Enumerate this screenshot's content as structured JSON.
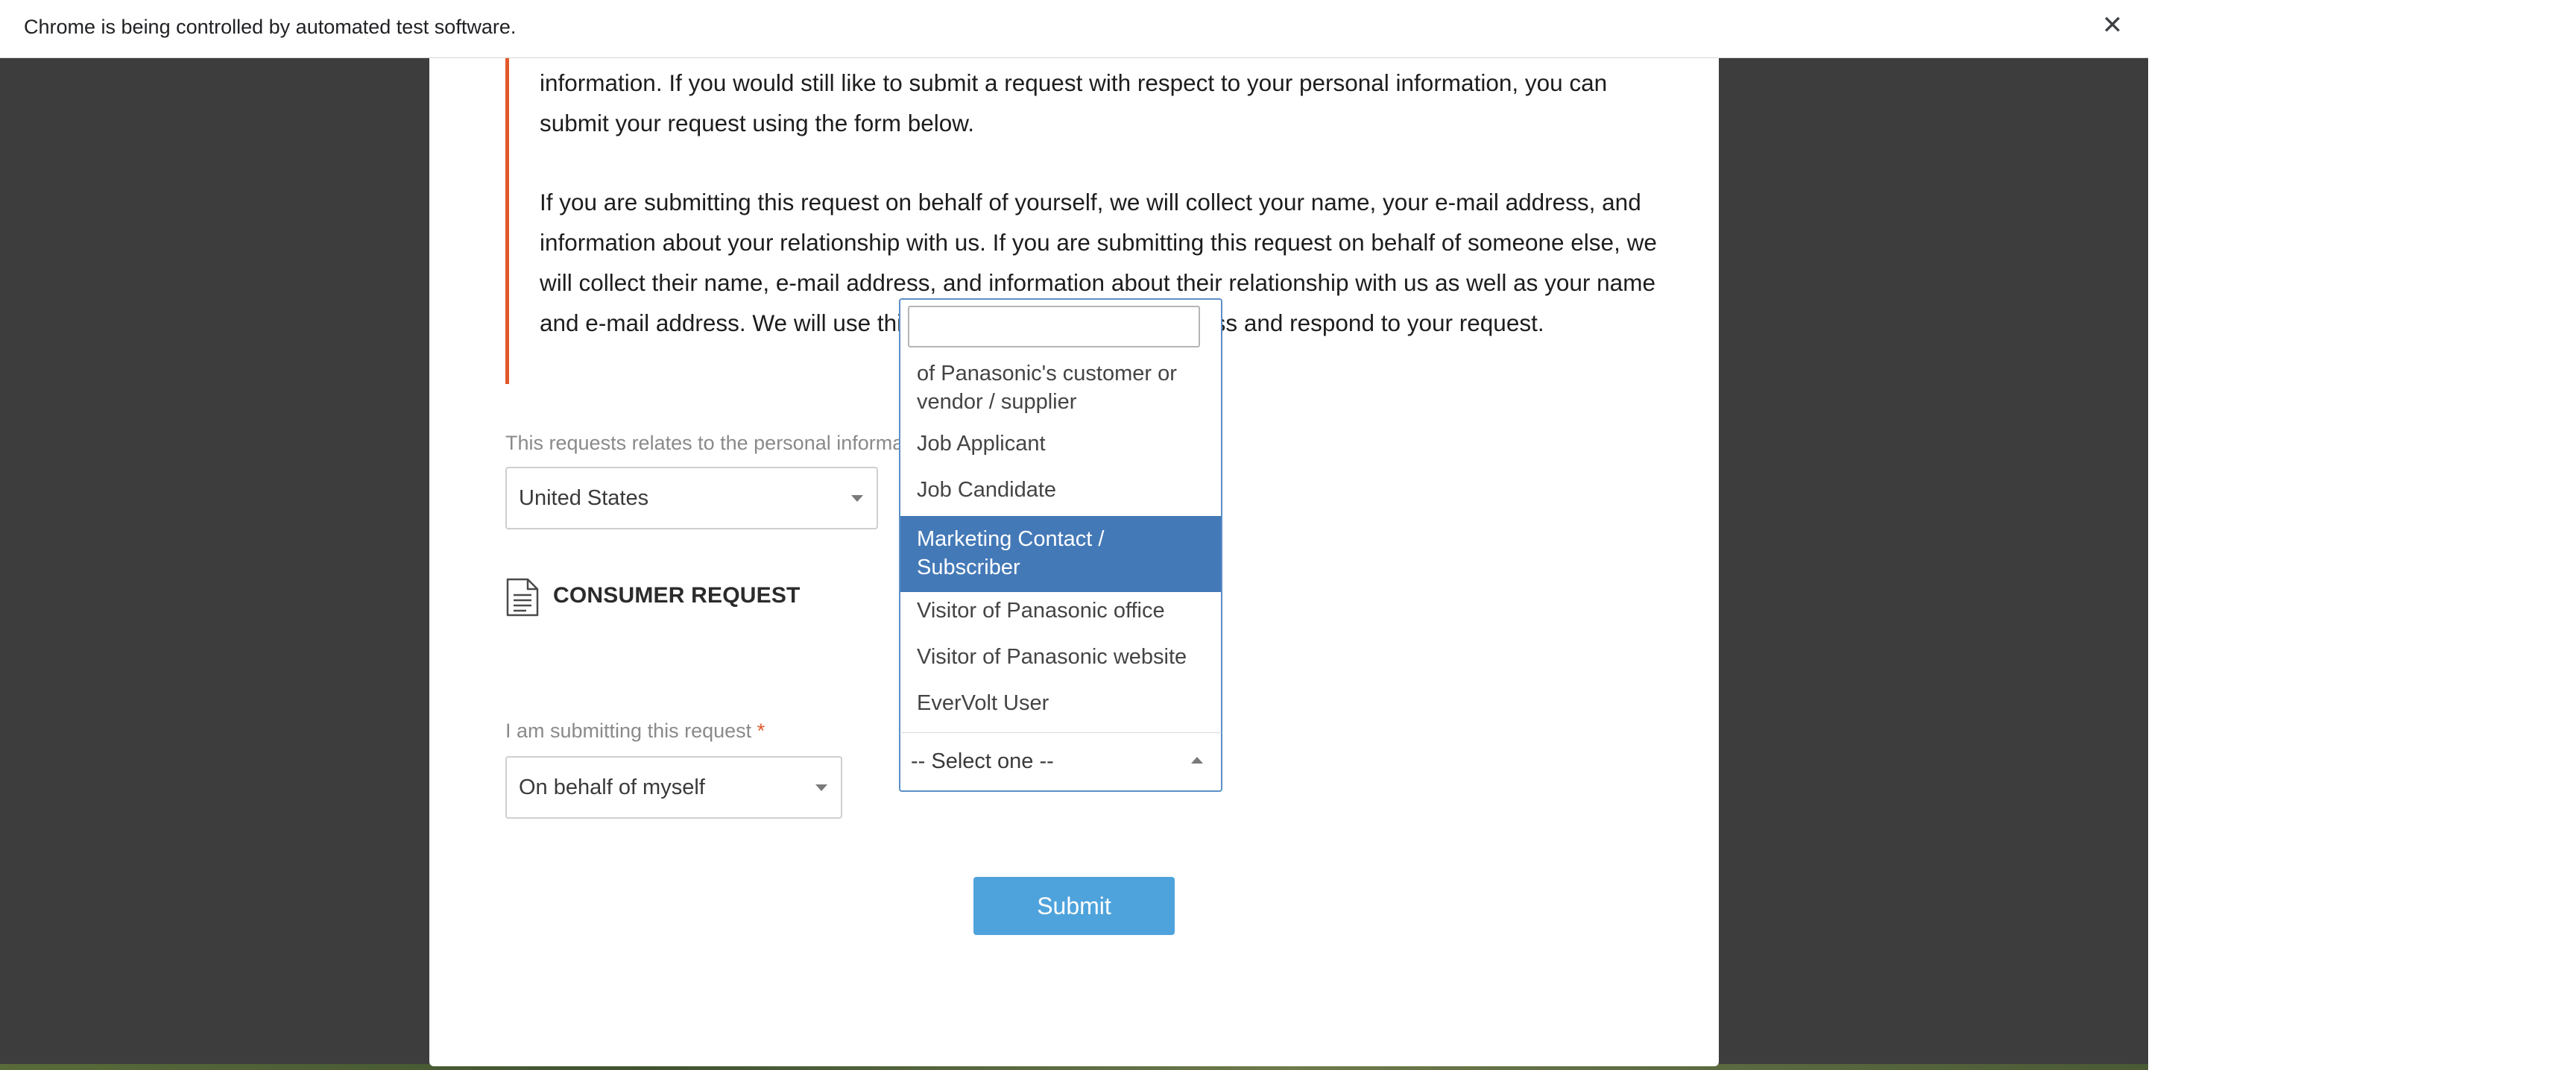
{
  "infobar": {
    "text": "Chrome is being controlled by automated test software.",
    "close_glyph": "✕"
  },
  "content": {
    "paragraph1": "information. If you would still like to submit a request with respect to your personal information, you can submit your request using the form below.",
    "paragraph2": "If you are submitting this request on behalf of yourself, we will collect your name, your e-mail address, and information about your relationship with us. If you are submitting this request on behalf of someone else, we will collect their name, e-mail address, and information about their relationship with us as well as your name and e-mail address. We will use this information in order to process and respond to your request."
  },
  "country": {
    "label": "This requests relates to the personal information",
    "value": "United States"
  },
  "section": {
    "title": "CONSUMER REQUEST",
    "icon": "document-icon"
  },
  "submitting": {
    "label": "I am submitting this request",
    "required_mark": "*",
    "value": "On behalf of myself"
  },
  "relationship_dropdown": {
    "search_value": "",
    "selected_value": "-- Select one --",
    "highlighted_index": 3,
    "options": [
      "of Panasonic's customer or vendor / supplier",
      "Job Applicant",
      "Job Candidate",
      "Marketing Contact / Subscriber",
      "Visitor of Panasonic office",
      "Visitor of Panasonic website",
      "EverVolt User"
    ]
  },
  "actions": {
    "submit_label": "Submit"
  },
  "colors": {
    "accent_bar": "#e0592a",
    "highlight": "#4479b7",
    "submit_bg": "#4fa3dc",
    "backdrop": "#3d3d3e"
  }
}
